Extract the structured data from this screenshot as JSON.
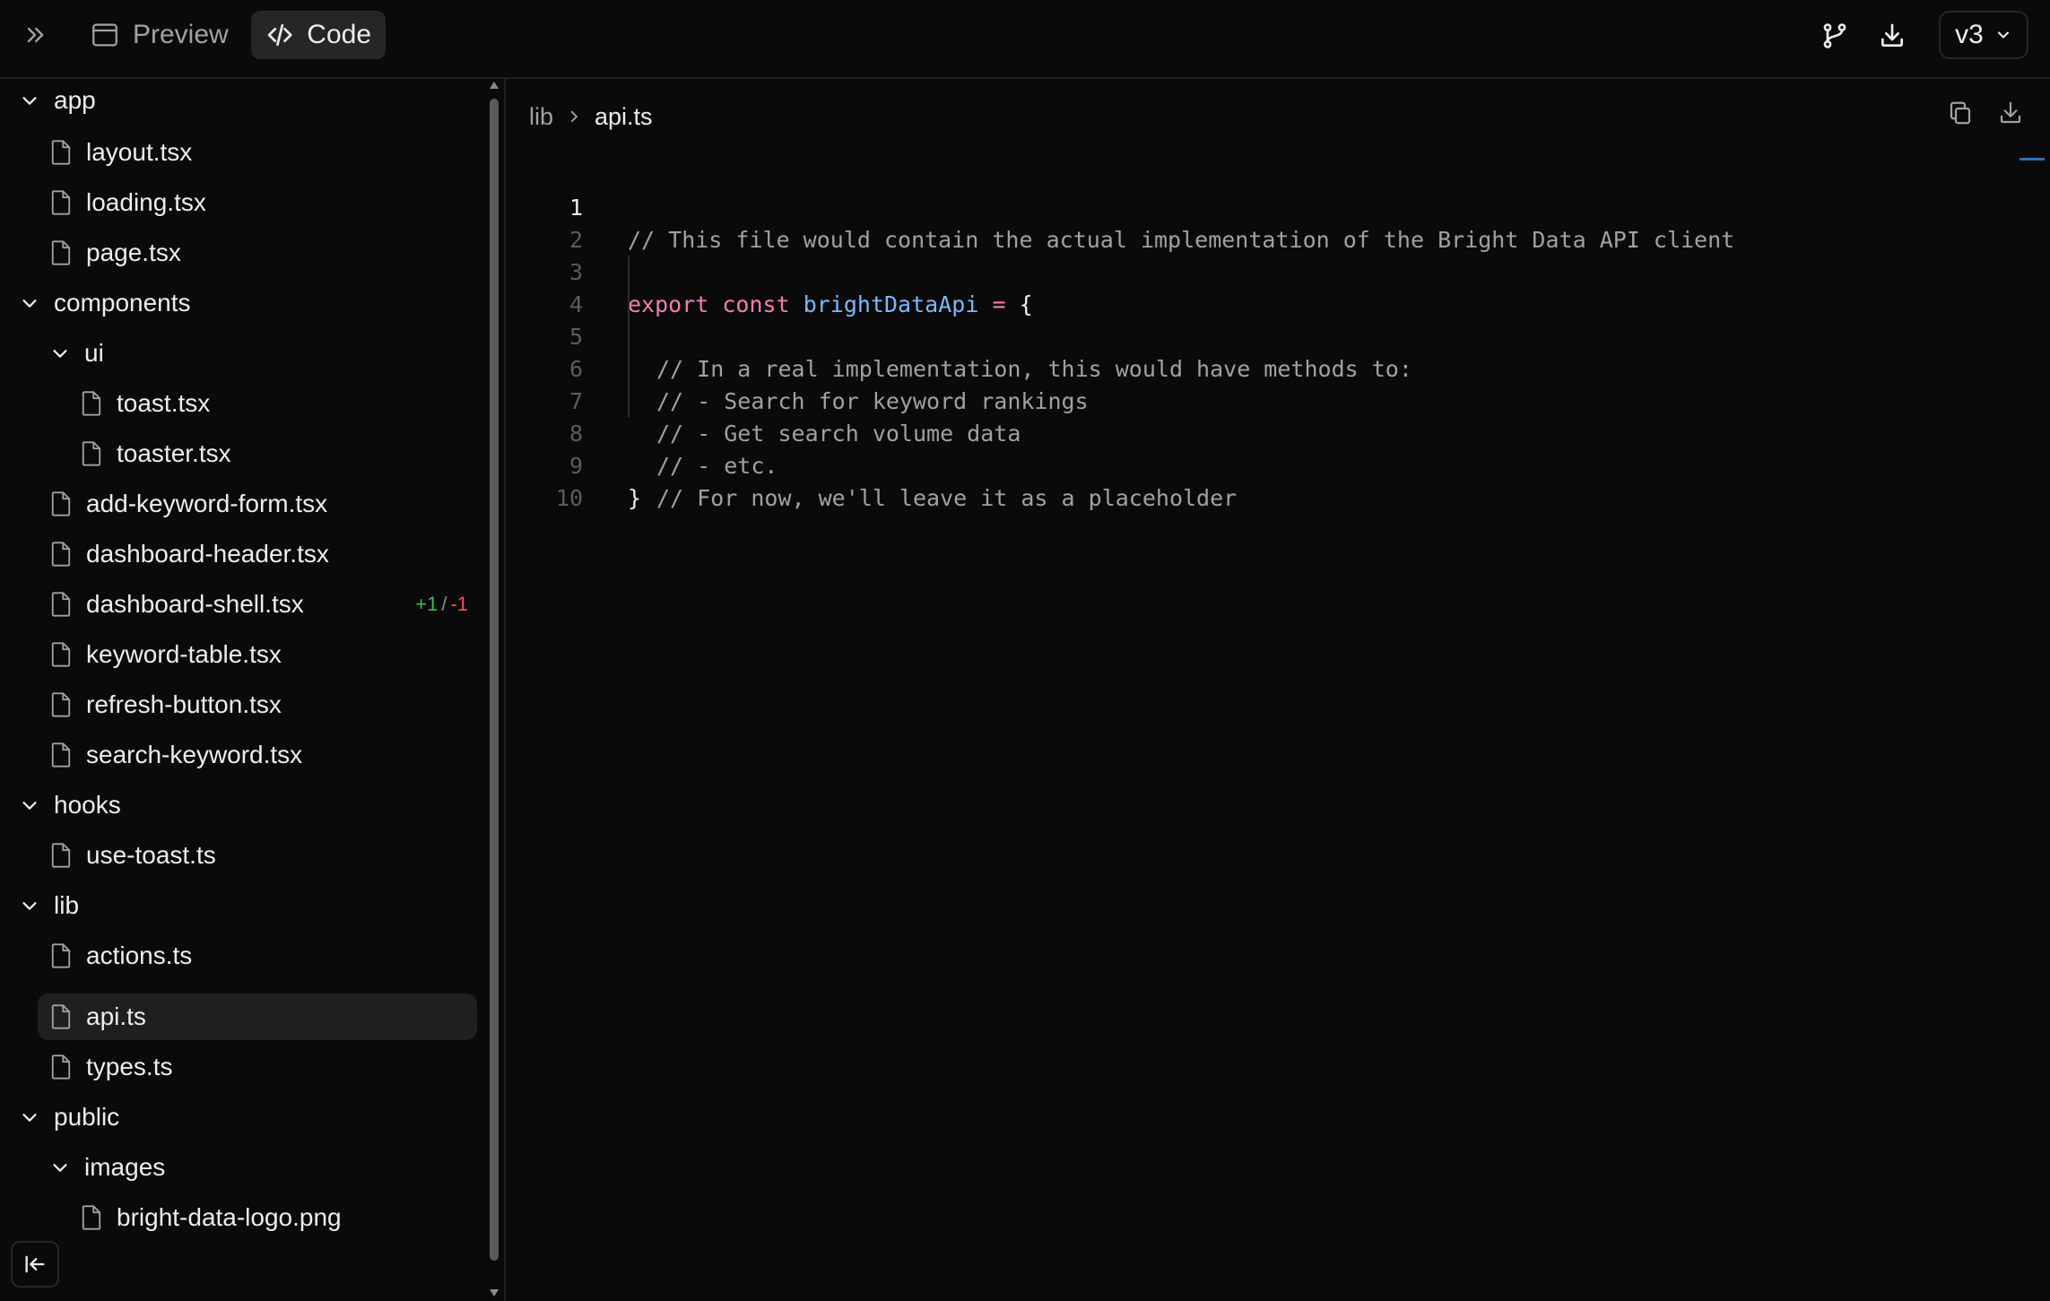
{
  "toolbar": {
    "preview_label": "Preview",
    "code_label": "Code",
    "version_label": "v3"
  },
  "breadcrumb": {
    "parent": "lib",
    "current": "api.ts"
  },
  "tree": {
    "items": [
      {
        "type": "folder",
        "label": "app"
      },
      {
        "type": "file",
        "label": "layout.tsx"
      },
      {
        "type": "file",
        "label": "loading.tsx"
      },
      {
        "type": "file",
        "label": "page.tsx"
      },
      {
        "type": "folder",
        "label": "components"
      },
      {
        "type": "folder",
        "label": "ui"
      },
      {
        "type": "file",
        "label": "toast.tsx"
      },
      {
        "type": "file",
        "label": "toaster.tsx"
      },
      {
        "type": "file",
        "label": "add-keyword-form.tsx"
      },
      {
        "type": "file",
        "label": "dashboard-header.tsx"
      },
      {
        "type": "file",
        "label": "dashboard-shell.tsx",
        "diff_add": "+1",
        "diff_sep": "/",
        "diff_del": "-1"
      },
      {
        "type": "file",
        "label": "keyword-table.tsx"
      },
      {
        "type": "file",
        "label": "refresh-button.tsx"
      },
      {
        "type": "file",
        "label": "search-keyword.tsx"
      },
      {
        "type": "folder",
        "label": "hooks"
      },
      {
        "type": "file",
        "label": "use-toast.ts"
      },
      {
        "type": "folder",
        "label": "lib"
      },
      {
        "type": "file",
        "label": "actions.ts"
      },
      {
        "type": "file",
        "label": "api.ts",
        "selected": true
      },
      {
        "type": "file",
        "label": "types.ts"
      },
      {
        "type": "folder",
        "label": "public"
      },
      {
        "type": "folder",
        "label": "images"
      },
      {
        "type": "file",
        "label": "bright-data-logo.png"
      }
    ]
  },
  "code": {
    "line_numbers": [
      "1",
      "2",
      "3",
      "4",
      "5",
      "6",
      "7",
      "8",
      "9",
      "10"
    ],
    "line1": "// This file would contain the actual implementation of the Bright Data API client",
    "line3_kw1": "export",
    "line3_kw2": "const",
    "line3_name": "brightDataApi",
    "line3_eq": "=",
    "line3_brace": "{",
    "line4": "// In a real implementation, this would have methods to:",
    "line5": "// - Search for keyword rankings",
    "line6": "// - Get search volume data",
    "line7": "// - etc.",
    "line8": "// For now, we'll leave it as a placeholder",
    "line9": "}"
  },
  "colors": {
    "keyword": "#f47cb4",
    "identifier": "#79b8ff",
    "diff_add": "#3fb950",
    "diff_del": "#f85149",
    "selected_bg": "#1f1f1f"
  }
}
